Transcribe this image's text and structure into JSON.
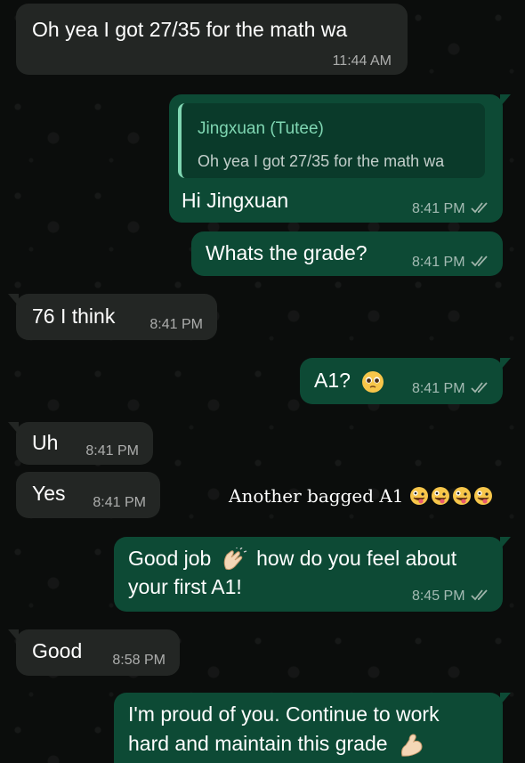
{
  "messages": [
    {
      "id": "m1",
      "dir": "in",
      "text": "Oh yea I got 27/35 for the math wa",
      "time": "11:44 AM"
    },
    {
      "id": "m2",
      "dir": "out",
      "reply_to": {
        "name": "Jingxuan (Tutee)",
        "text": "Oh yea I got 27/35 for the math wa"
      },
      "text": "Hi Jingxuan",
      "time": "8:41 PM"
    },
    {
      "id": "m3",
      "dir": "out",
      "text": "Whats the grade?",
      "time": "8:41 PM"
    },
    {
      "id": "m4",
      "dir": "in",
      "text": "76 I think",
      "time": "8:41 PM"
    },
    {
      "id": "m5",
      "dir": "out",
      "text": "A1?",
      "emoji": "pleading-face",
      "time": "8:41 PM"
    },
    {
      "id": "m6",
      "dir": "in",
      "text": "Uh",
      "time": "8:41 PM"
    },
    {
      "id": "m7",
      "dir": "in",
      "text": "Yes",
      "time": "8:41 PM"
    },
    {
      "id": "m8",
      "dir": "out",
      "text_line1_a": "Good job",
      "emoji": "clapping-hands",
      "text_line1_b": "how do you feel about",
      "text_line2": "your first A1!",
      "time": "8:45 PM"
    },
    {
      "id": "m9",
      "dir": "in",
      "text": "Good",
      "time": "8:58 PM"
    },
    {
      "id": "m10",
      "dir": "out",
      "text_line1": "I'm proud of you. Continue to work",
      "text_line2": "hard and maintain this grade",
      "emoji": "flexed-biceps"
    }
  ],
  "caption": {
    "text": "Another bagged A1",
    "emojis": [
      "zany-face",
      "zany-face",
      "zany-face",
      "zany-face"
    ]
  },
  "colors": {
    "incoming": "#232624",
    "outgoing": "#0d4a35",
    "reply_name": "#7fd6b2",
    "read_ticks": "#9fb4aa"
  }
}
